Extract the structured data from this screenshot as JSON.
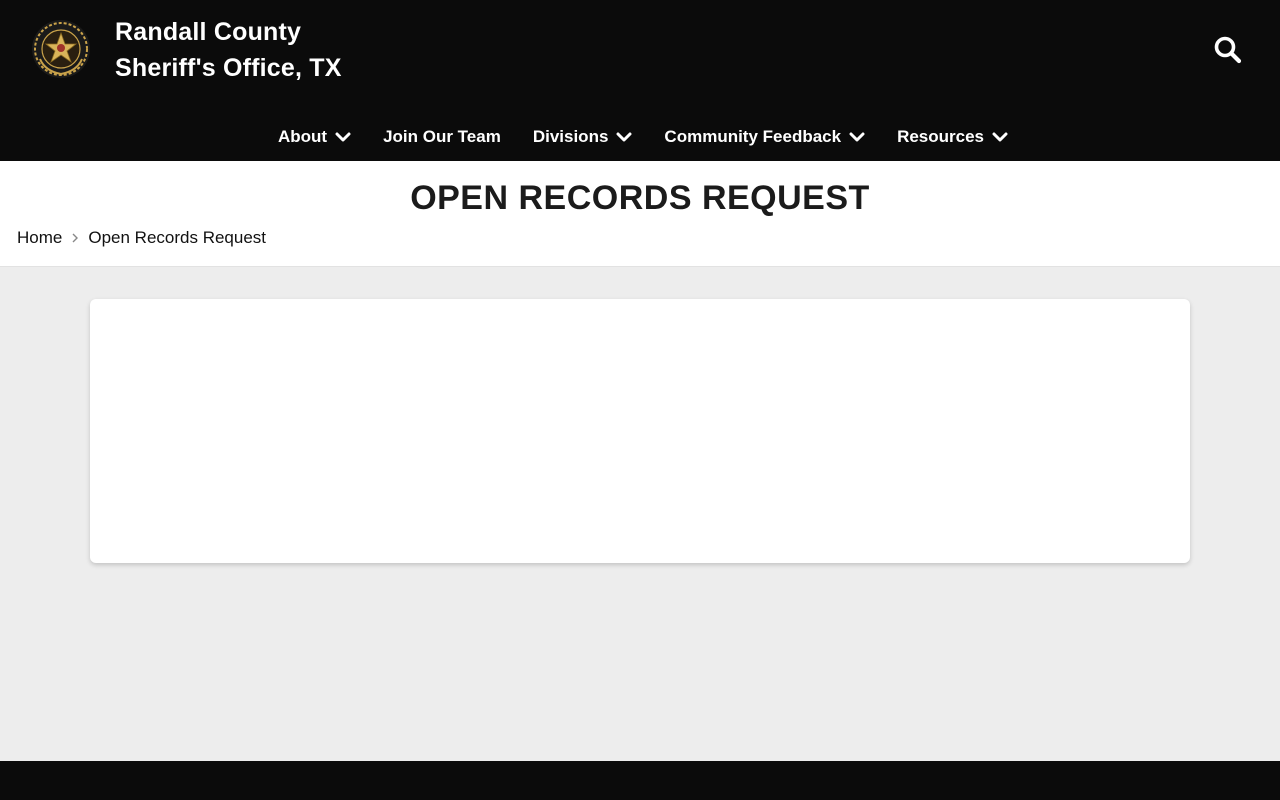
{
  "colors": {
    "header_bg": "#0b0b0b",
    "page_bg": "#ededed",
    "text_dark": "#1b1b1b",
    "badge_gold": "#c9a24a"
  },
  "header": {
    "logo_icon": "sheriff-star-badge-icon",
    "title_line1": "Randall County",
    "title_line2": "Sheriff's Office, TX",
    "search_icon": "search-icon"
  },
  "nav": {
    "items": [
      {
        "label": "About",
        "has_dropdown": true
      },
      {
        "label": "Join Our Team",
        "has_dropdown": false
      },
      {
        "label": "Divisions",
        "has_dropdown": true
      },
      {
        "label": "Community Feedback",
        "has_dropdown": true
      },
      {
        "label": "Resources",
        "has_dropdown": true
      }
    ]
  },
  "page": {
    "title": "OPEN RECORDS REQUEST"
  },
  "breadcrumb": {
    "home": "Home",
    "current": "Open Records Request"
  }
}
